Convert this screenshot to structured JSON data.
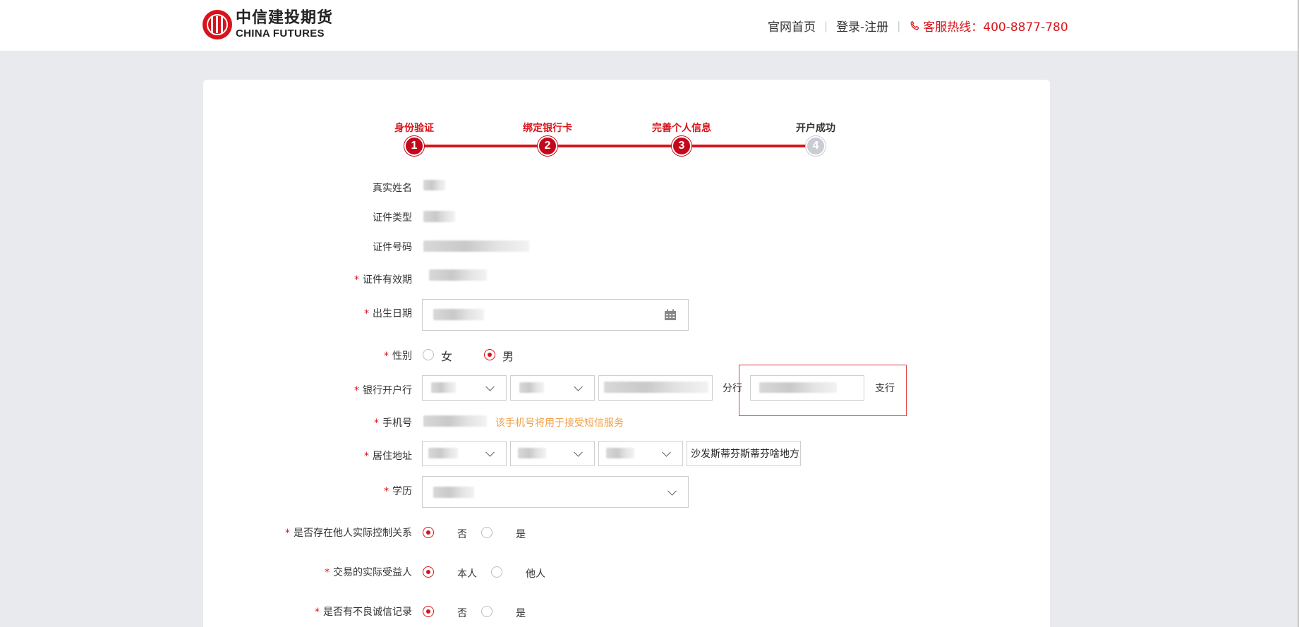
{
  "header": {
    "logo_cn": "中信建投期货",
    "logo_en": "CHINA FUTURES",
    "nav": {
      "home": "官网首页",
      "login": "登录-注册",
      "hotline": "客服热线：400-8877-780"
    }
  },
  "steps": [
    {
      "label": "身份验证",
      "num": "1",
      "state": "done"
    },
    {
      "label": "绑定银行卡",
      "num": "2",
      "state": "done"
    },
    {
      "label": "完善个人信息",
      "num": "3",
      "state": "current"
    },
    {
      "label": "开户成功",
      "num": "4",
      "state": "pending"
    }
  ],
  "form": {
    "real_name": "真实姓名",
    "id_type": "证件类型",
    "id_number": "证件号码",
    "id_validity": "证件有效期",
    "birth_date": "出生日期",
    "gender": {
      "label": "性别",
      "options": [
        "女",
        "男"
      ],
      "selected": "男"
    },
    "bank": {
      "label": "银行开户行",
      "branch_suffix": "分行",
      "sub_branch_suffix": "支行"
    },
    "phone": {
      "label": "手机号",
      "hint": "该手机号将用于接受短信服务"
    },
    "address": {
      "label": "居住地址",
      "detail": "沙发斯蒂芬斯蒂芬啥地方"
    },
    "education": "学历",
    "control_relation": {
      "label": "是否存在他人实际控制关系",
      "options": [
        "否",
        "是"
      ],
      "selected": "否"
    },
    "beneficiary": {
      "label": "交易的实际受益人",
      "options": [
        "本人",
        "他人"
      ],
      "selected": "本人"
    },
    "bad_credit": {
      "label": "是否有不良诚信记录",
      "options": [
        "否",
        "是"
      ],
      "selected": "否"
    }
  },
  "colors": {
    "brand_red": "#d7141b",
    "hint_orange": "#f0a14a",
    "page_bg": "#e9eaed"
  }
}
